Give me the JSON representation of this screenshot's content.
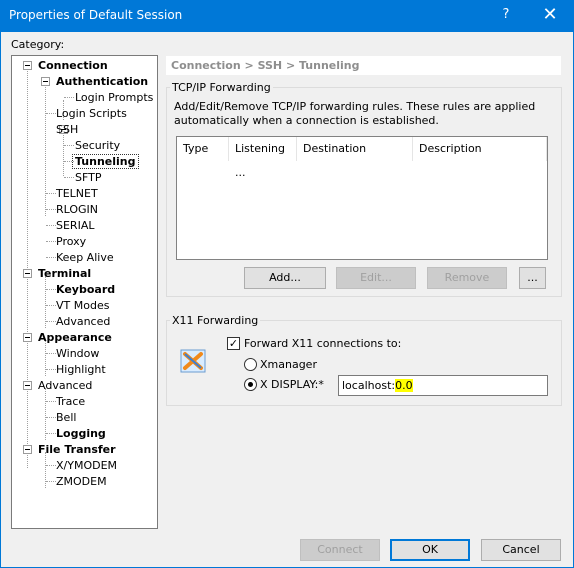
{
  "window": {
    "title": "Properties of Default Session",
    "help_glyph": "?",
    "close_glyph": "✕"
  },
  "category_label": "Category:",
  "tree": [
    {
      "label": "Connection",
      "bold": true
    },
    {
      "label": "Authentication",
      "bold": true
    },
    {
      "label": "Login Prompts",
      "bold": false
    },
    {
      "label": "Login Scripts",
      "bold": false
    },
    {
      "label": "SSH",
      "bold": false
    },
    {
      "label": "Security",
      "bold": false
    },
    {
      "label": "Tunneling",
      "bold": true,
      "selected": true
    },
    {
      "label": "SFTP",
      "bold": false
    },
    {
      "label": "TELNET",
      "bold": false
    },
    {
      "label": "RLOGIN",
      "bold": false
    },
    {
      "label": "SERIAL",
      "bold": false
    },
    {
      "label": "Proxy",
      "bold": false
    },
    {
      "label": "Keep Alive",
      "bold": false
    },
    {
      "label": "Terminal",
      "bold": true
    },
    {
      "label": "Keyboard",
      "bold": true
    },
    {
      "label": "VT Modes",
      "bold": false
    },
    {
      "label": "Advanced",
      "bold": false
    },
    {
      "label": "Appearance",
      "bold": true
    },
    {
      "label": "Window",
      "bold": false
    },
    {
      "label": "Highlight",
      "bold": false
    },
    {
      "label": "Advanced",
      "bold": false
    },
    {
      "label": "Trace",
      "bold": false
    },
    {
      "label": "Bell",
      "bold": false
    },
    {
      "label": "Logging",
      "bold": true
    },
    {
      "label": "File Transfer",
      "bold": true
    },
    {
      "label": "X/YMODEM",
      "bold": false
    },
    {
      "label": "ZMODEM",
      "bold": false
    }
  ],
  "breadcrumb": "Connection > SSH > Tunneling",
  "tcpip": {
    "group_label": "TCP/IP Forwarding",
    "description": "Add/Edit/Remove TCP/IP forwarding rules. These rules are applied automatically when a connection is established.",
    "columns": [
      "Type",
      "Listening ...",
      "Destination",
      "Description"
    ],
    "buttons": {
      "add": "Add...",
      "edit": "Edit...",
      "remove": "Remove",
      "more": "..."
    }
  },
  "x11": {
    "group_label": "X11 Forwarding",
    "forward_label": "Forward X11 connections to:",
    "forward_checked": true,
    "xmanager_label": "Xmanager",
    "display_label": "X DISPLAY:*",
    "display_selected": true,
    "display_value_plain": "localhost:",
    "display_value_highlight": "0.0"
  },
  "footer": {
    "connect": "Connect",
    "ok": "OK",
    "cancel": "Cancel"
  },
  "colors": {
    "titlebar": "#0078d7",
    "highlight": "#ffff00",
    "breadcrumb_text": "#8e8e8e"
  }
}
